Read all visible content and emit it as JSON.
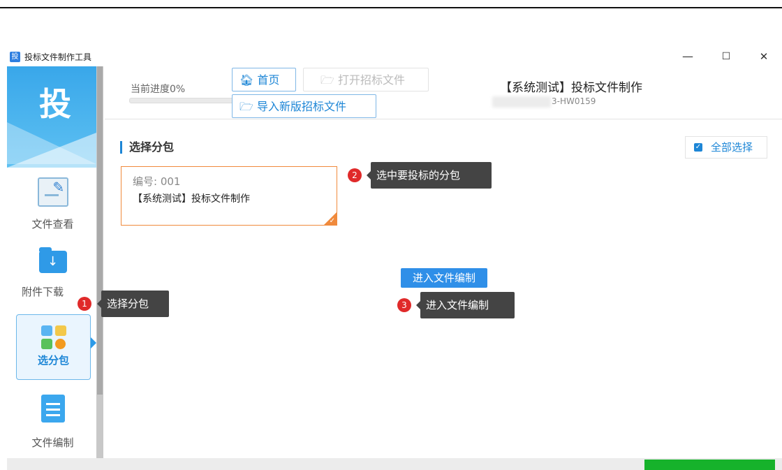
{
  "window": {
    "app_icon": "投",
    "title": "投标文件制作工具",
    "controls": {
      "minimize": "—",
      "maximize": "☐",
      "close": "✕"
    }
  },
  "sidebar": {
    "logo": "投",
    "items": [
      {
        "label": "文件查看",
        "icon": "document-edit-icon"
      },
      {
        "label": "附件下载",
        "icon": "folder-download-icon"
      },
      {
        "label": "选分包",
        "icon": "package-grid-icon",
        "active": true
      },
      {
        "label": "文件编制",
        "icon": "document-compose-icon"
      }
    ]
  },
  "header": {
    "progress_label": "当前进度0%",
    "progress_percent": 0,
    "home_button": "首页",
    "home_icon": "home-icon",
    "open_button": "打开招标文件",
    "import_button": "导入新版招标文件",
    "folder_icon": "folder-open-icon",
    "project_title": "【系统测试】投标文件制作",
    "project_code": "3-HW0159"
  },
  "main": {
    "section_title": "选择分包",
    "select_all_label": "全部选择",
    "select_all_checked": true,
    "packages": [
      {
        "number": "编号: 001",
        "name": "【系统测试】投标文件制作",
        "selected": true
      }
    ],
    "enter_button": "进入文件编制"
  },
  "tips": [
    {
      "num": "1",
      "text": "选择分包"
    },
    {
      "num": "2",
      "text": "选中要投标的分包"
    },
    {
      "num": "3",
      "text": "进入文件编制"
    }
  ],
  "colors": {
    "accent": "#1d86d6",
    "selected_border": "#f08a3c",
    "tip_bg": "#444444",
    "badge": "#e02a2a",
    "status_green": "#16b22b"
  }
}
